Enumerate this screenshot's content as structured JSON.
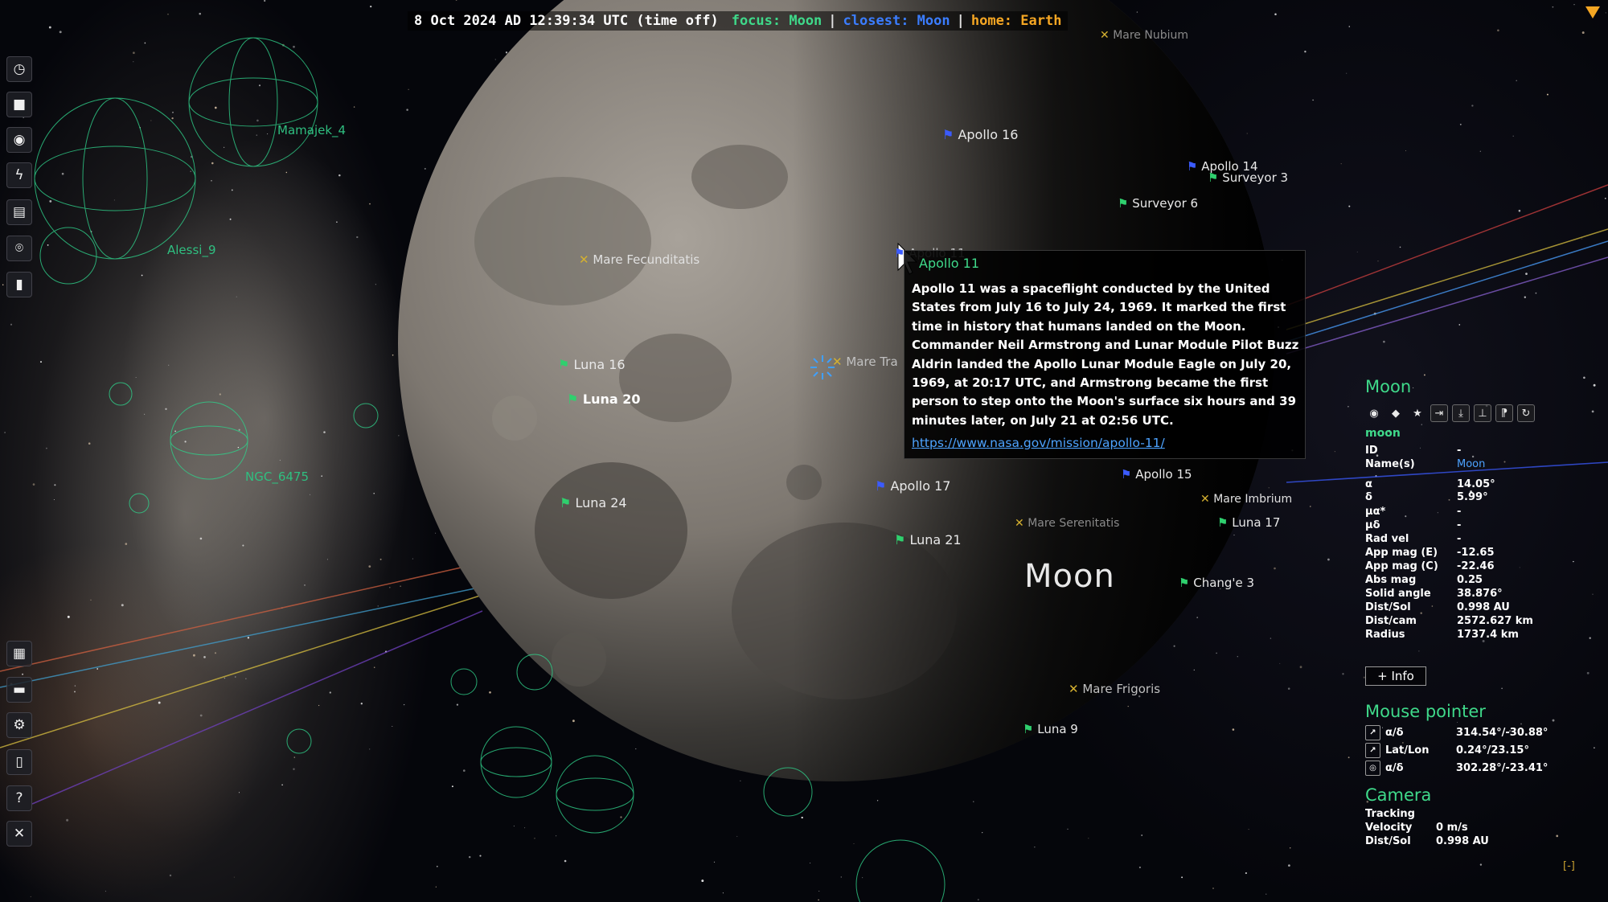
{
  "topbar": {
    "time": "8 Oct 2024 AD 12:39:34 UTC (time off)",
    "focus": "focus: Moon",
    "closest": "closest: Moon",
    "home": "home: Earth",
    "separator": "|"
  },
  "toolbar": {
    "top": [
      {
        "name": "time-icon",
        "glyph": "◷"
      },
      {
        "name": "camera-icon",
        "glyph": "■"
      },
      {
        "name": "visibility-icon",
        "glyph": "◉"
      },
      {
        "name": "lightning-icon",
        "glyph": "ϟ"
      },
      {
        "name": "dataset-icon",
        "glyph": "▤"
      },
      {
        "name": "location-icon",
        "glyph": "⌾"
      },
      {
        "name": "bookmark-icon",
        "glyph": "▮"
      }
    ],
    "bottom": [
      {
        "name": "map-icon",
        "glyph": "▦"
      },
      {
        "name": "folder-icon",
        "glyph": "▬"
      },
      {
        "name": "gear-icon",
        "glyph": "⚙"
      },
      {
        "name": "log-icon",
        "glyph": "▯"
      },
      {
        "name": "help-icon",
        "glyph": "?"
      },
      {
        "name": "close-icon",
        "glyph": "✕"
      }
    ]
  },
  "scene": {
    "moon_label": "Moon",
    "clusters": [
      "Mamajek_4",
      "Alessi_9",
      "NGC_6475"
    ],
    "maria": [
      "Mare Nubium",
      "Mare Fecunditatis",
      "Mare Tra",
      "Mare Imbrium",
      "Mare Serenitatis",
      "Mare Frigoris"
    ],
    "landing_sites": [
      {
        "label": "Apollo 16",
        "color": "#3b5bff"
      },
      {
        "label": "Apollo 14",
        "color": "#3b5bff"
      },
      {
        "label": "Surveyor 3",
        "color": "#2fd06e"
      },
      {
        "label": "Surveyor 6",
        "color": "#2fd06e"
      },
      {
        "label": "Apollo 11",
        "color": "#3b5bff"
      },
      {
        "label": "Luna 16",
        "color": "#2fd06e"
      },
      {
        "label": "Luna 20",
        "color": "#2fd06e"
      },
      {
        "label": "Apollo 17",
        "color": "#3b5bff"
      },
      {
        "label": "Apollo 15",
        "color": "#3b5bff"
      },
      {
        "label": "Luna 17",
        "color": "#2fd06e"
      },
      {
        "label": "Luna 24",
        "color": "#2fd06e"
      },
      {
        "label": "Luna 21",
        "color": "#2fd06e"
      },
      {
        "label": "Chang'e 3",
        "color": "#2fd06e"
      },
      {
        "label": "Luna 9",
        "color": "#2fd06e"
      }
    ]
  },
  "tooltip": {
    "title": "Apollo 11",
    "body": "Apollo 11 was a spaceflight conducted by the United States from July 16 to July 24, 1969. It marked the first time in history that humans landed on the Moon. Commander Neil Armstrong and Lunar Module Pilot Buzz Aldrin landed the Apollo Lunar Module Eagle on July 20, 1969, at 20:17 UTC, and Armstrong became the first person to step onto the Moon's surface six hours and 39 minutes later, on July 21 at 02:56 UTC.",
    "link": "https://www.nasa.gov/mission/apollo-11/"
  },
  "panel": {
    "title": "Moon",
    "subname": "moon",
    "rows": [
      {
        "k": "ID",
        "v": "-"
      },
      {
        "k": "Name(s)",
        "v": "Moon"
      },
      {
        "k": "α",
        "v": "14.05°"
      },
      {
        "k": "δ",
        "v": "5.99°"
      },
      {
        "k": "μα*",
        "v": "-"
      },
      {
        "k": "μδ",
        "v": "-"
      },
      {
        "k": "Rad vel",
        "v": "-"
      },
      {
        "k": "App mag (E)",
        "v": "-12.65"
      },
      {
        "k": "App mag (C)",
        "v": "-22.46"
      },
      {
        "k": "Abs mag",
        "v": "0.25"
      },
      {
        "k": "Solid angle",
        "v": "38.876°"
      },
      {
        "k": "Dist/Sol",
        "v": "0.998 AU"
      },
      {
        "k": "Dist/cam",
        "v": "2572.627 km"
      },
      {
        "k": "Radius",
        "v": "1737.4 km"
      }
    ],
    "more_info": "+ Info",
    "mouse_title": "Mouse pointer",
    "mouse_rows": [
      {
        "k": "α/δ",
        "v": "314.54°/-30.88°"
      },
      {
        "k": "Lat/Lon",
        "v": "0.24°/23.15°"
      },
      {
        "k": "α/δ",
        "v": "302.28°/-23.41°"
      }
    ],
    "camera_title": "Camera",
    "camera_mode": "Tracking",
    "camera_rows": [
      {
        "k": "Velocity",
        "v": "0 m/s"
      },
      {
        "k": "Dist/Sol",
        "v": "0.998 AU"
      }
    ]
  },
  "status_corner": "[-]"
}
